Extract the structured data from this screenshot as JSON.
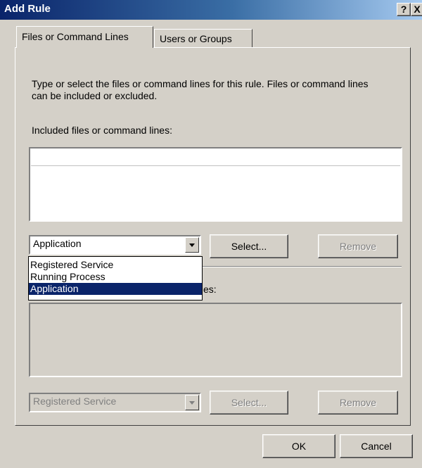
{
  "window": {
    "title": "Add Rule",
    "help_label": "?",
    "close_label": "X"
  },
  "tabs": [
    {
      "label": "Files or Command Lines",
      "active": true
    },
    {
      "label": "Users or Groups",
      "active": false
    }
  ],
  "files_tab": {
    "description": "Type or select the files or command lines for this rule. Files or command lines can be included or excluded.",
    "included_label": "Included files or command lines:",
    "included_items": [],
    "excluded_label_partial": "es:",
    "excluded_items": []
  },
  "included_controls": {
    "type_value": "Application",
    "select_label": "Select...",
    "remove_label": "Remove",
    "dropdown_options": [
      "Registered Service",
      "Running Process",
      "Application"
    ],
    "dropdown_selected": "Application"
  },
  "excluded_controls": {
    "type_value": "Registered Service",
    "select_label": "Select...",
    "remove_label": "Remove"
  },
  "footer": {
    "ok_label": "OK",
    "cancel_label": "Cancel"
  }
}
